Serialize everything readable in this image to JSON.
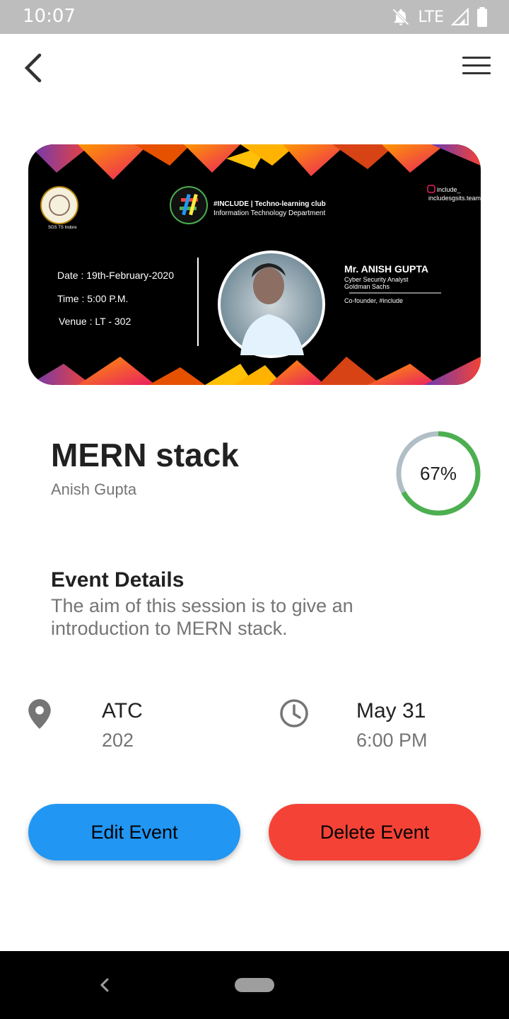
{
  "status_bar": {
    "time": "10:07",
    "network": "LTE",
    "icons": [
      "bell-off-icon",
      "signal-icon",
      "battery-icon"
    ]
  },
  "app_bar": {
    "back_icon": "back-arrow-icon",
    "menu_icon": "hamburger-menu-icon"
  },
  "banner": {
    "club_line1": "#INCLUDE | Techno-learning club",
    "club_line2": "Information Technology Department",
    "institute_caption": "SGS TS Indore",
    "social_handle1": "include_",
    "social_handle2": "includesgsits.team",
    "date_line": "Date : 19th-February-2020",
    "time_line": "Time : 5:00 P.M.",
    "venue_line": "Venue : LT - 302",
    "speaker_name": "Mr. ANISH GUPTA",
    "speaker_role1": "Cyber Security Analyst",
    "speaker_role2": "Goldman Sachs",
    "speaker_role3": "Co-founder, #include"
  },
  "event": {
    "title": "MERN stack",
    "speaker": "Anish Gupta",
    "progress_label": "67%",
    "progress_value": 0.67,
    "details_heading": "Event Details",
    "details_text": "The aim of this session is to give an introduction to MERN stack."
  },
  "location": {
    "icon": "location-pin-icon",
    "title": "ATC",
    "subtitle": "202"
  },
  "schedule": {
    "icon": "clock-icon",
    "title": "May 31",
    "subtitle": "6:00 PM"
  },
  "actions": {
    "edit_label": "Edit Event",
    "delete_label": "Delete Event"
  },
  "colors": {
    "edit_button": "#2196f3",
    "delete_button": "#f44336",
    "progress_fill": "#4caf50",
    "progress_track": "#b0bec5",
    "status_bar": "#bdbdbd"
  }
}
